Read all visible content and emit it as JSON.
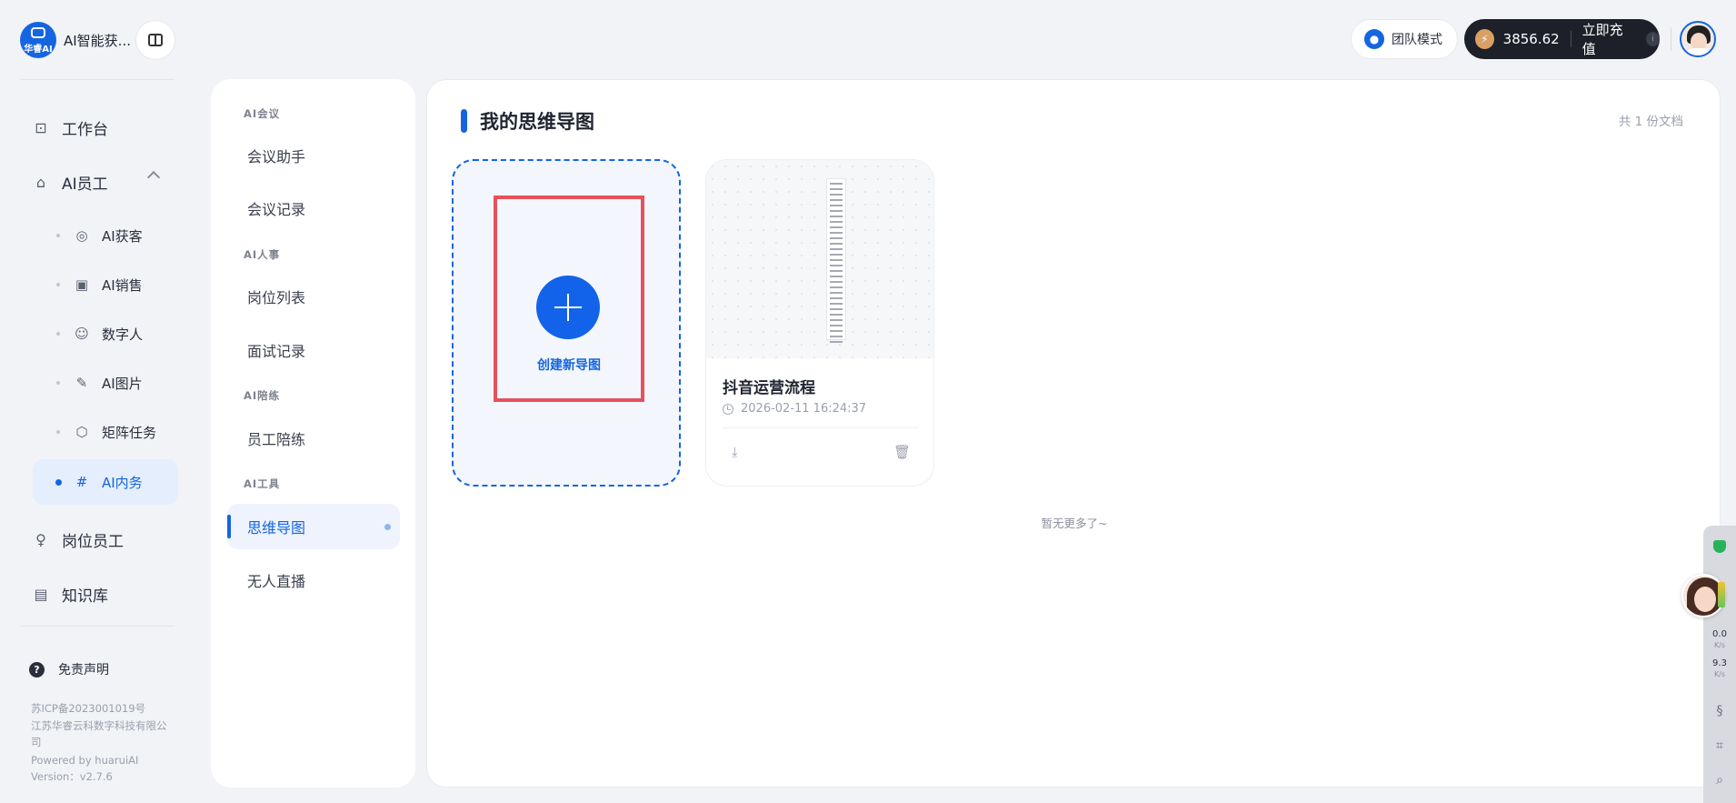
{
  "brand": {
    "logo_text": "华睿AI",
    "name": "AI智能获..."
  },
  "sidebar": {
    "workbench": "工作台",
    "ai_staff": "AI员工",
    "sub_items": [
      {
        "label": "AI获客",
        "icon": "user-circle-icon"
      },
      {
        "label": "AI销售",
        "icon": "chart-plus-icon"
      },
      {
        "label": "数字人",
        "icon": "digital-human-icon"
      },
      {
        "label": "AI图片",
        "icon": "brush-icon"
      },
      {
        "label": "矩阵任务",
        "icon": "cube-icon"
      },
      {
        "label": "AI内务",
        "icon": "hash-icon"
      }
    ],
    "position_staff": "岗位员工",
    "knowledge_base": "知识库",
    "disclaimer": "免责声明",
    "footer": {
      "icp": "苏ICP备2023001019号",
      "company": "江苏华睿云科数字科技有限公司",
      "powered": "Powered by huaruiAI",
      "version": "Version：v2.7.6"
    }
  },
  "submenu": {
    "groups": [
      {
        "title": "AI会议",
        "items": [
          "会议助手",
          "会议记录"
        ]
      },
      {
        "title": "AI人事",
        "items": [
          "岗位列表",
          "面试记录"
        ]
      },
      {
        "title": "AI陪练",
        "items": [
          "员工陪练"
        ]
      },
      {
        "title": "AI工具",
        "items": [
          "思维导图",
          "无人直播"
        ]
      }
    ],
    "active": "思维导图"
  },
  "topbar": {
    "team_mode": "团队模式",
    "balance": "3856.62",
    "recharge": "立即充值",
    "info": "i"
  },
  "main": {
    "title": "我的思维导图",
    "count": "共 1 份文档",
    "create_label": "创建新导图",
    "doc": {
      "title": "抖音运营流程",
      "time": "2026-02-11 16:24:37"
    },
    "no_more": "暂无更多了~"
  },
  "float_widget": {
    "up_value": "0.0",
    "up_unit": "K/s",
    "down_value": "9.3",
    "down_unit": "K/s"
  },
  "colors": {
    "accent": "#1565e0",
    "highlight_border": "#e8505b",
    "dark_pill": "#1d2028"
  }
}
